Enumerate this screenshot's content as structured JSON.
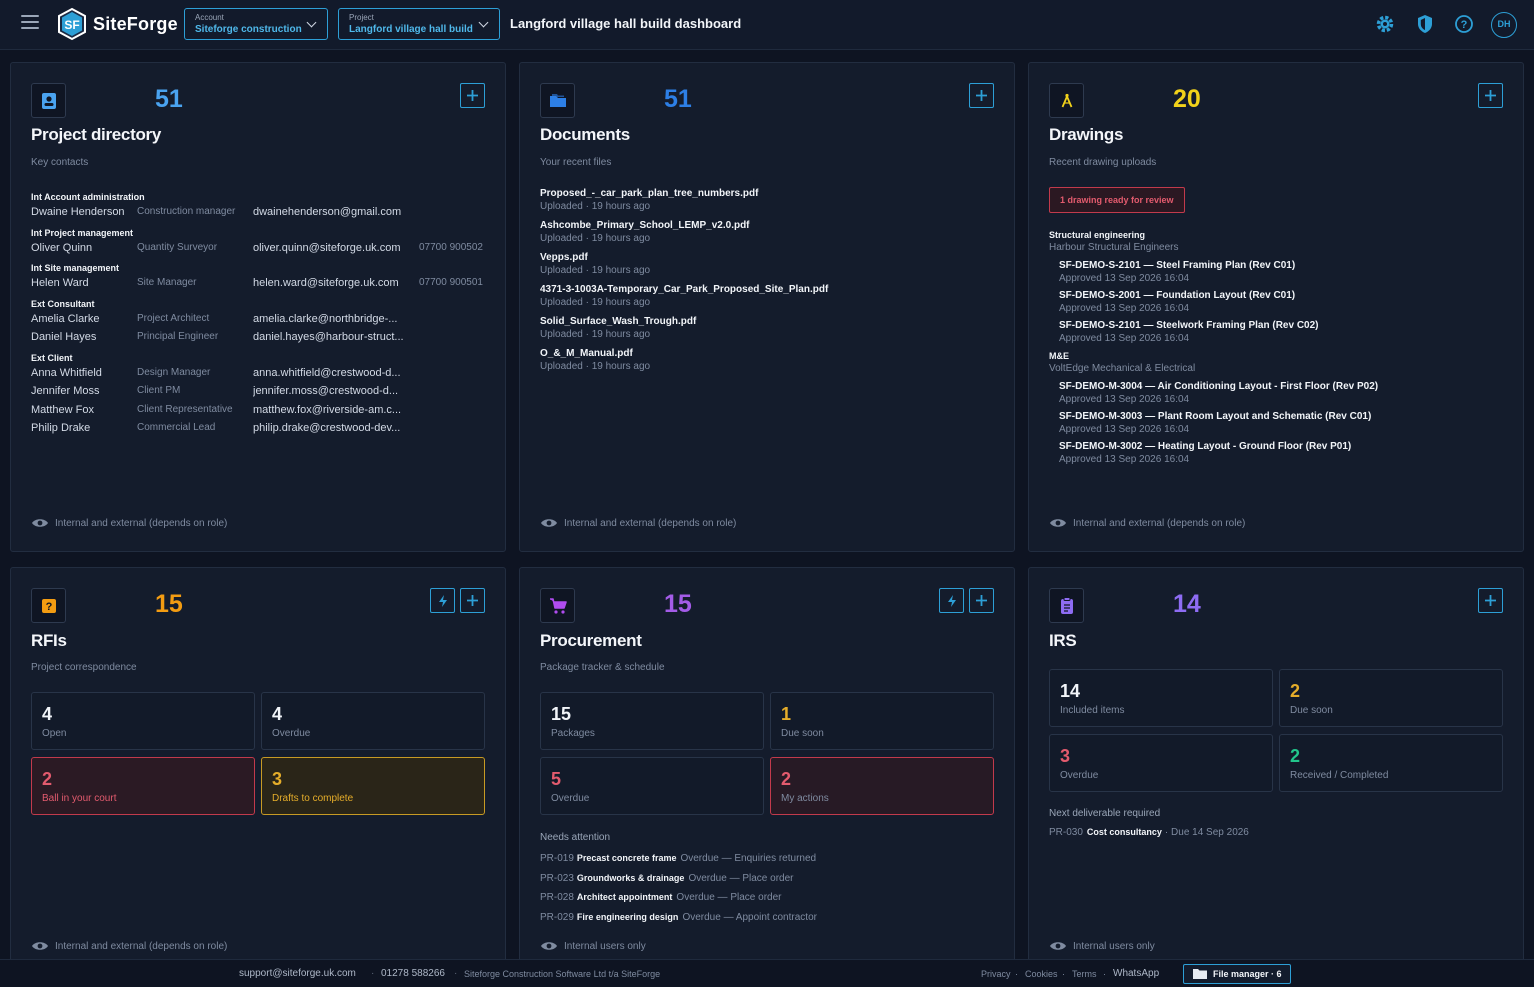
{
  "app": {
    "name": "SiteForge",
    "account": {
      "label": "Account",
      "value": "Siteforge construction"
    },
    "project": {
      "label": "Project",
      "value": "Langford village hall build"
    },
    "dashboard_title": "Langford village hall build dashboard",
    "avatar_initials": "DH"
  },
  "colors": {
    "accent": "#2d9fd6",
    "blue": "#4aa3f0",
    "yellow": "#f2d21a",
    "orange": "#f39c12",
    "purple": "#a45ce8",
    "violet": "#8e6cf3",
    "red": "#e35b6e",
    "green": "#22c58b"
  },
  "directory": {
    "count": "51",
    "title": "Project directory",
    "subtitle": "Key contacts",
    "groups": [
      {
        "name": "Int Account administration",
        "contacts": [
          {
            "name": "Dwaine Henderson",
            "role": "Construction manager",
            "email": "dwainehenderson@gmail.com",
            "phone": ""
          }
        ]
      },
      {
        "name": "Int Project management",
        "contacts": [
          {
            "name": "Oliver Quinn",
            "role": "Quantity Surveyor",
            "email": "oliver.quinn@siteforge.uk.com",
            "phone": "07700 900502"
          }
        ]
      },
      {
        "name": "Int Site management",
        "contacts": [
          {
            "name": "Helen Ward",
            "role": "Site Manager",
            "email": "helen.ward@siteforge.uk.com",
            "phone": "07700 900501"
          }
        ]
      },
      {
        "name": "Ext Consultant",
        "contacts": [
          {
            "name": "Amelia Clarke",
            "role": "Project Architect",
            "email": "amelia.clarke@northbridge-...",
            "phone": ""
          },
          {
            "name": "Daniel Hayes",
            "role": "Principal Engineer",
            "email": "daniel.hayes@harbour-struct...",
            "phone": ""
          }
        ]
      },
      {
        "name": "Ext Client",
        "contacts": [
          {
            "name": "Anna Whitfield",
            "role": "Design Manager",
            "email": "anna.whitfield@crestwood-d...",
            "phone": ""
          },
          {
            "name": "Jennifer Moss",
            "role": "Client PM",
            "email": "jennifer.moss@crestwood-d...",
            "phone": ""
          },
          {
            "name": "Matthew Fox",
            "role": "Client Representative",
            "email": "matthew.fox@riverside-am.c...",
            "phone": ""
          },
          {
            "name": "Philip Drake",
            "role": "Commercial Lead",
            "email": "philip.drake@crestwood-dev...",
            "phone": ""
          }
        ]
      }
    ],
    "footer": "Internal and external (depends on role)"
  },
  "documents": {
    "count": "51",
    "title": "Documents",
    "subtitle": "Your recent files",
    "items": [
      {
        "name": "Proposed_-_car_park_plan_tree_numbers.pdf",
        "meta": "Uploaded · 19 hours ago"
      },
      {
        "name": "Ashcombe_Primary_School_LEMP_v2.0.pdf",
        "meta": "Uploaded · 19 hours ago"
      },
      {
        "name": "Vepps.pdf",
        "meta": "Uploaded · 19 hours ago"
      },
      {
        "name": "4371-3-1003A-Temporary_Car_Park_Proposed_Site_Plan.pdf",
        "meta": "Uploaded · 19 hours ago"
      },
      {
        "name": "Solid_Surface_Wash_Trough.pdf",
        "meta": "Uploaded · 19 hours ago"
      },
      {
        "name": "O_&_M_Manual.pdf",
        "meta": "Uploaded · 19 hours ago"
      }
    ],
    "footer": "Internal and external (depends on role)"
  },
  "drawings": {
    "count": "20",
    "title": "Drawings",
    "subtitle": "Recent drawing uploads",
    "review_badge": "1 drawing ready for review",
    "groups": [
      {
        "name": "Structural engineering",
        "org": "Harbour Structural Engineers",
        "items": [
          {
            "title": "SF-DEMO-S-2101 — Steel Framing Plan (Rev C01)",
            "meta": "Approved 13 Sep 2026 16:04"
          },
          {
            "title": "SF-DEMO-S-2001 — Foundation Layout (Rev C01)",
            "meta": "Approved 13 Sep 2026 16:04"
          },
          {
            "title": "SF-DEMO-S-2101 — Steelwork Framing Plan (Rev C02)",
            "meta": "Approved 13 Sep 2026 16:04"
          }
        ]
      },
      {
        "name": "M&E",
        "org": "VoltEdge Mechanical & Electrical",
        "items": [
          {
            "title": "SF-DEMO-M-3004 — Air Conditioning Layout - First Floor (Rev P02)",
            "meta": "Approved 13 Sep 2026 16:04"
          },
          {
            "title": "SF-DEMO-M-3003 — Plant Room Layout and Schematic (Rev C01)",
            "meta": "Approved 13 Sep 2026 16:04"
          },
          {
            "title": "SF-DEMO-M-3002 — Heating Layout - Ground Floor (Rev P01)",
            "meta": "Approved 13 Sep 2026 16:04"
          }
        ]
      }
    ],
    "footer": "Internal and external (depends on role)"
  },
  "rfis": {
    "count": "15",
    "title": "RFIs",
    "subtitle": "Project correspondence",
    "tiles": [
      {
        "value": "4",
        "label": "Open"
      },
      {
        "value": "4",
        "label": "Overdue"
      },
      {
        "value": "2",
        "label": "Ball in your court"
      },
      {
        "value": "3",
        "label": "Drafts to complete"
      }
    ],
    "footer": "Internal and external (depends on role)"
  },
  "procurement": {
    "count": "15",
    "title": "Procurement",
    "subtitle": "Package tracker & schedule",
    "tiles": [
      {
        "value": "15",
        "label": "Packages"
      },
      {
        "value": "1",
        "label": "Due soon"
      },
      {
        "value": "5",
        "label": "Overdue"
      },
      {
        "value": "2",
        "label": "My actions"
      }
    ],
    "attention_heading": "Needs attention",
    "attention": [
      {
        "id": "PR-019",
        "name": "Precast concrete frame",
        "status": "Overdue — Enquiries returned"
      },
      {
        "id": "PR-023",
        "name": "Groundworks & drainage",
        "status": "Overdue — Place order"
      },
      {
        "id": "PR-028",
        "name": "Architect appointment",
        "status": "Overdue — Place order"
      },
      {
        "id": "PR-029",
        "name": "Fire engineering design",
        "status": "Overdue — Appoint contractor"
      }
    ],
    "footer": "Internal users only"
  },
  "irs": {
    "count": "14",
    "title": "IRS",
    "tiles": [
      {
        "value": "14",
        "label": "Included items"
      },
      {
        "value": "2",
        "label": "Due soon"
      },
      {
        "value": "3",
        "label": "Overdue"
      },
      {
        "value": "2",
        "label": "Received / Completed"
      }
    ],
    "next_heading": "Next deliverable required",
    "next": {
      "id": "PR-030",
      "name": "Cost consultancy",
      "due": "· Due 14 Sep 2026"
    },
    "footer": "Internal users only"
  },
  "bottom": {
    "email": "support@siteforge.uk.com",
    "phone": "01278 588266",
    "company": "Siteforge Construction Software Ltd t/a SiteForge",
    "privacy": "Privacy",
    "cookies": "Cookies",
    "terms": "Terms",
    "whatsapp": "WhatsApp",
    "file_manager": "File manager · 6"
  }
}
